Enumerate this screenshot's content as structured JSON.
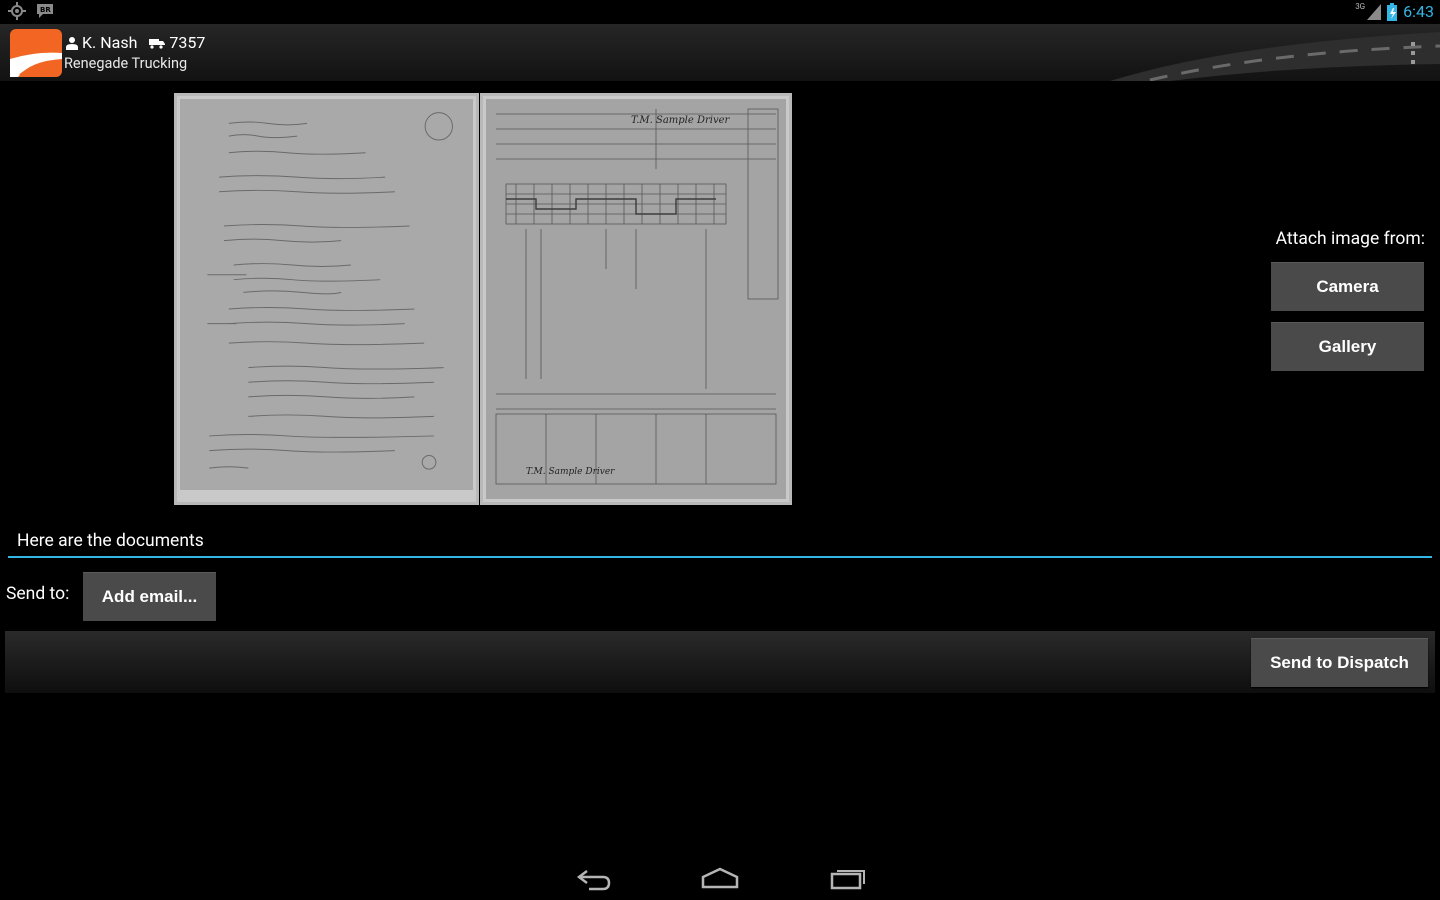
{
  "status_bar": {
    "network_label": "3G",
    "time": "6:43",
    "left_icons": [
      "gps-icon",
      "notification-icon"
    ],
    "right_icons": [
      "signal-icon",
      "battery-icon"
    ]
  },
  "action_bar": {
    "driver_name": "K. Nash",
    "truck_number": "7357",
    "company": "Renegade Trucking",
    "icons": [
      "app-logo",
      "person-icon",
      "truck-icon",
      "overflow-menu-icon"
    ]
  },
  "attachments": [
    {
      "name": "attachment-handwritten-notes",
      "description_icon": "document-image"
    },
    {
      "name": "attachment-drivers-daily-log",
      "description_icon": "document-image"
    }
  ],
  "attach_section": {
    "label": "Attach image from:",
    "camera_label": "Camera",
    "gallery_label": "Gallery"
  },
  "message": {
    "value": "Here are the documents"
  },
  "recipients": {
    "label": "Send to:",
    "add_email_label": "Add email..."
  },
  "footer": {
    "send_label": "Send to Dispatch"
  },
  "colors": {
    "accent": "#33b5e5",
    "button_bg": "#4a4a4a",
    "logo_orange": "#f26522"
  }
}
